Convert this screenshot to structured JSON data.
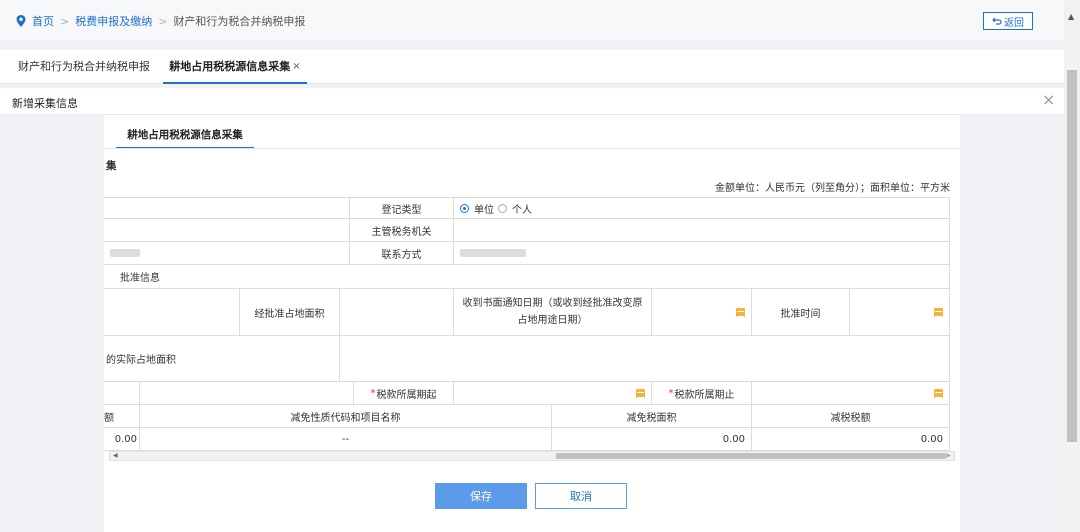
{
  "breadcrumb": {
    "home": "首页",
    "level1": "税费申报及缴纳",
    "current": "财产和行为税合并纳税申报",
    "separator": ">"
  },
  "back_button": {
    "label": "返回"
  },
  "tabs": [
    {
      "label": "财产和行为税合并纳税申报"
    },
    {
      "label": "耕地占用税税源信息采集",
      "close": "×"
    }
  ],
  "modal": {
    "title": "新增采集信息",
    "close": "×"
  },
  "sub_tab": {
    "label": "耕地占用税税源信息采集"
  },
  "section_label": "集",
  "unit_note": "金额单位：人民币元（列至角分）；面积单位：平方米",
  "form": {
    "reg_type_label": "登记类型",
    "reg_options": [
      "单位",
      "个人"
    ],
    "reg_selected": 0,
    "tax_office_label": "主管税务机关",
    "tax_office_value": "",
    "contact_label": "联系方式",
    "approval_info_label": "批准信息",
    "approved_area_label": "经批准占地面积",
    "approved_area_value": "",
    "notice_date_label": "收到书面通知日期（或收到经批准改变原占地用途日期）",
    "approval_time_label": "批准时间",
    "actual_area_label": "的实际占地面积",
    "period_start_label": "税款所属期起",
    "period_end_label": "税款所属期止",
    "required_mark": "*"
  },
  "relief_table": {
    "headers": [
      "额",
      "减免性质代码和项目名称",
      "减免税面积",
      "减税税额"
    ],
    "row": {
      "amount": "0.00",
      "code_name": "--",
      "relief_area": "0.00",
      "relief_tax": "0.00"
    }
  },
  "buttons": {
    "save": "保存",
    "cancel": "取消"
  },
  "icons": {
    "location": "location-pin-icon",
    "calendar": "calendar-icon",
    "back": "return-arrow-icon"
  },
  "colors": {
    "accent": "#1f6fd1",
    "save_button": "#5b9bea",
    "calendar": "#f3b33d",
    "required": "#e23"
  }
}
